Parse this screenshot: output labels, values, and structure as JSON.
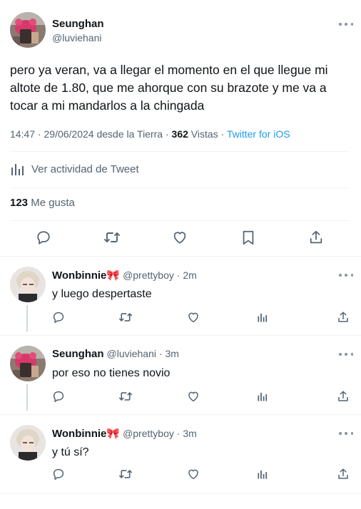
{
  "main": {
    "name": "Seunghan",
    "handle": "@luviehani",
    "text": "pero ya veran, va a llegar el momento en el que llegue mi altote de 1.80, que me ahorque con su brazote y me va a tocar a mi mandarlos a la chingada",
    "time": "14:47",
    "date": "29/06/2024",
    "location": "desde la Tierra",
    "views_count": "362",
    "views_label": "Vistas",
    "source": "Twitter for iOS",
    "activity_label": "Ver actividad de Tweet",
    "likes_count": "123",
    "likes_label": "Me gusta"
  },
  "replies": [
    {
      "name": "Wonbinnie🎀",
      "handle": "@prettyboy",
      "time": "2m",
      "text": "y luego despertaste"
    },
    {
      "name": "Seunghan",
      "handle": "@luviehani",
      "time": "3m",
      "text": "por eso no tienes novio"
    },
    {
      "name": "Wonbinnie🎀",
      "handle": "@prettyboy",
      "time": "3m",
      "text": "y tú sí?"
    }
  ],
  "colors": {
    "accent": "#1d9bf0",
    "text": "#0f1419",
    "secondary": "#536471",
    "divider": "#eff3f4"
  },
  "icons": [
    "reply-icon",
    "retweet-icon",
    "like-icon",
    "bookmark-icon",
    "share-icon",
    "analytics-icon",
    "more-icon"
  ]
}
